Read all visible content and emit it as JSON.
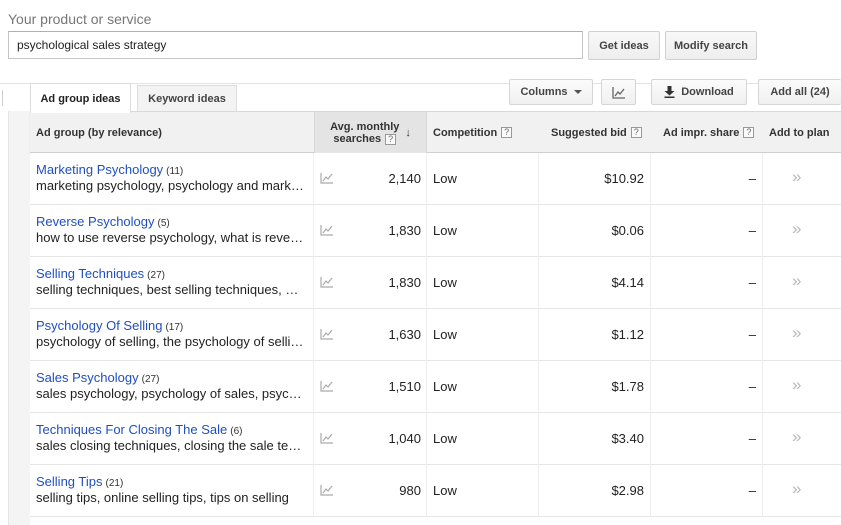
{
  "search": {
    "label": "Your product or service",
    "query": "psychological sales strategy",
    "get_ideas": "Get ideas",
    "modify_search": "Modify search"
  },
  "tabs": {
    "ad_group": "Ad group ideas",
    "keyword": "Keyword ideas"
  },
  "toolbar": {
    "columns": "Columns",
    "download": "Download",
    "add_all": "Add all (24)"
  },
  "table": {
    "headers": {
      "ad_group": "Ad group (by relevance)",
      "avg_line1": "Avg. monthly",
      "avg_line2": "searches",
      "competition": "Competition",
      "bid": "Suggested bid",
      "impr": "Ad impr. share",
      "plan": "Add to plan",
      "help": "?"
    },
    "rows": [
      {
        "name": "Marketing Psychology",
        "count": "(11)",
        "keywords": "marketing psychology, psychology and marketing",
        "searches": "2,140",
        "competition": "Low",
        "bid": "$10.92",
        "impr": "–",
        "add": "»"
      },
      {
        "name": "Reverse Psychology",
        "count": "(5)",
        "keywords": "how to use reverse psychology, what is reverse psychology",
        "searches": "1,830",
        "competition": "Low",
        "bid": "$0.06",
        "impr": "–",
        "add": "»"
      },
      {
        "name": "Selling Techniques",
        "count": "(27)",
        "keywords": "selling techniques, best selling techniques, sales techniques",
        "searches": "1,830",
        "competition": "Low",
        "bid": "$4.14",
        "impr": "–",
        "add": "»"
      },
      {
        "name": "Psychology Of Selling",
        "count": "(17)",
        "keywords": "psychology of selling, the psychology of selling",
        "searches": "1,630",
        "competition": "Low",
        "bid": "$1.12",
        "impr": "–",
        "add": "»"
      },
      {
        "name": "Sales Psychology",
        "count": "(27)",
        "keywords": "sales psychology, psychology of sales, psychology sales",
        "searches": "1,510",
        "competition": "Low",
        "bid": "$1.78",
        "impr": "–",
        "add": "»"
      },
      {
        "name": "Techniques For Closing The Sale",
        "count": "(6)",
        "keywords": "sales closing techniques, closing the sale techniques",
        "searches": "1,040",
        "competition": "Low",
        "bid": "$3.40",
        "impr": "–",
        "add": "»"
      },
      {
        "name": "Selling Tips",
        "count": "(21)",
        "keywords": "selling tips, online selling tips, tips on selling",
        "searches": "980",
        "competition": "Low",
        "bid": "$2.98",
        "impr": "–",
        "add": "»"
      }
    ]
  }
}
